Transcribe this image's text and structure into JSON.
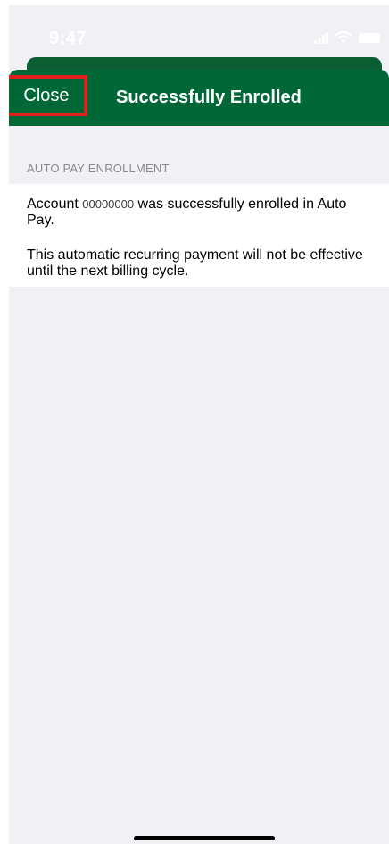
{
  "status_bar": {
    "time": "9:47"
  },
  "nav": {
    "close_label": "Close",
    "title": "Successfully Enrolled"
  },
  "section": {
    "header": "AUTO PAY ENROLLMENT"
  },
  "message": {
    "line1_prefix": "Account ",
    "account_number": "00000000",
    "line1_suffix": " was successfully enrolled in Auto Pay.",
    "line2": "This automatic recurring payment will not be effective until the next billing cycle."
  },
  "colors": {
    "brand_green": "#006837",
    "highlight_red": "#e01f1f",
    "background": "#f1f1f5"
  }
}
